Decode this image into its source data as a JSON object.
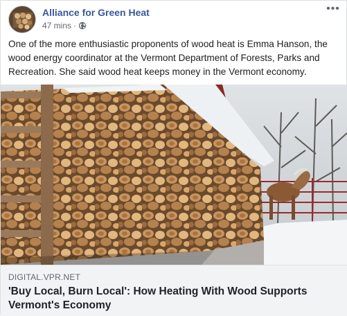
{
  "post": {
    "page_name": "Alliance for Green Heat",
    "timestamp": "47 mins",
    "separator": "·",
    "privacy_icon": "globe-icon",
    "more_icon": "more-options-icon",
    "more_glyph": "•••",
    "text": "One of the more enthusiastic proponents of wood heat is Emma Hanson, the wood energy coordinator at the Vermont Department of Forests, Parks and Recreation. She said wood heat keeps money in the Vermont economy."
  },
  "link": {
    "domain": "DIGITAL.VPR.NET",
    "title": "'Buy Local, Burn Local': How Heating With Wood Supports Vermont's Economy"
  },
  "colors": {
    "page_name": "#385898",
    "meta": "#616770",
    "footer_bg": "#f2f3f5"
  }
}
